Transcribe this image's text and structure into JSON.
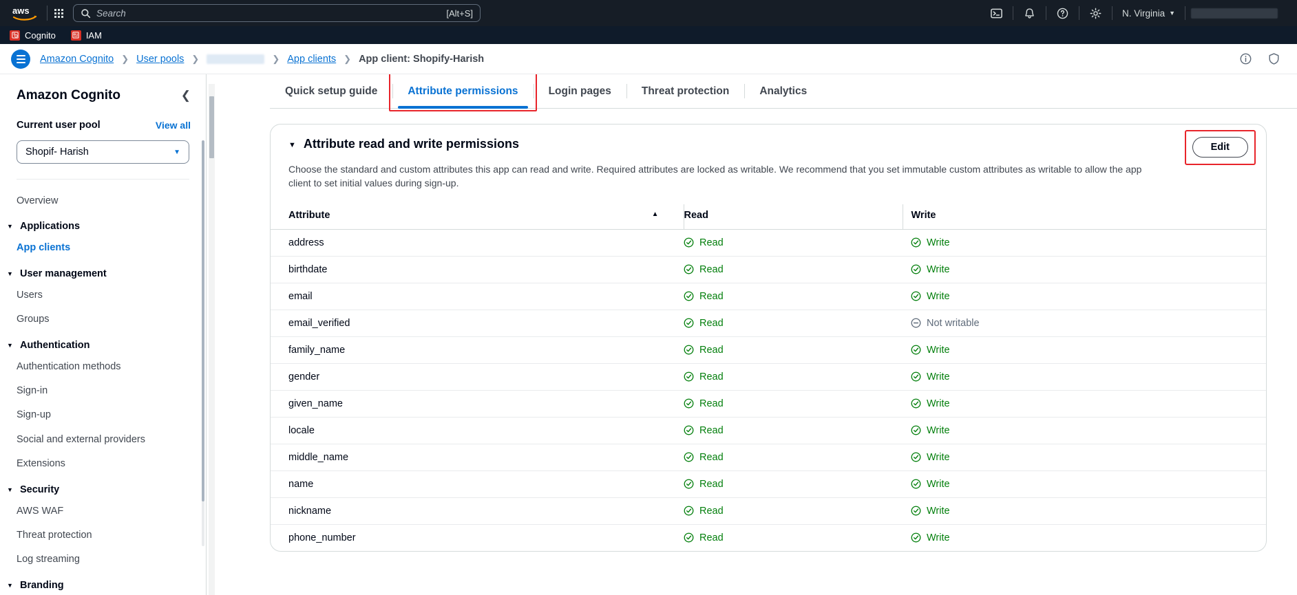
{
  "topnav": {
    "logo": "aws",
    "apps_icon": "app-grid-icon",
    "search_placeholder": "Search",
    "search_value": "",
    "search_shortcut": "[Alt+S]",
    "cloudshell_icon": "cloudshell-icon",
    "notifications_icon": "bell-icon",
    "help_icon": "question-circle-icon",
    "settings_icon": "gear-icon",
    "region": "N. Virginia",
    "region_caret": "chevron-down-icon",
    "account": ""
  },
  "service_bar": {
    "items": [
      {
        "label": "Cognito",
        "icon": "cognito-service-icon"
      },
      {
        "label": "IAM",
        "icon": "iam-service-icon"
      }
    ]
  },
  "breadcrumb": {
    "menu_icon": "hamburger-menu-icon",
    "items": [
      {
        "label": "Amazon Cognito",
        "type": "link"
      },
      {
        "label": "User pools",
        "type": "link"
      },
      {
        "label": "",
        "type": "redacted"
      },
      {
        "label": "App clients",
        "type": "link"
      },
      {
        "label": "App client: Shopify-Harish",
        "type": "current"
      }
    ],
    "separator": "›",
    "info_icon": "info-circle-icon",
    "feedback_icon": "shield-icon"
  },
  "sidebar": {
    "title": "Amazon Cognito",
    "collapse_icon": "chevron-left-icon",
    "pool_label": "Current user pool",
    "view_all": "View all",
    "pool_selected": "Shopif- Harish",
    "pool_caret": "chevron-down-icon",
    "nav": [
      {
        "type": "link",
        "label": "Overview",
        "active": false
      },
      {
        "type": "group",
        "label": "Applications"
      },
      {
        "type": "link",
        "label": "App clients",
        "active": true
      },
      {
        "type": "group",
        "label": "User management"
      },
      {
        "type": "link",
        "label": "Users",
        "active": false
      },
      {
        "type": "link",
        "label": "Groups",
        "active": false
      },
      {
        "type": "group",
        "label": "Authentication"
      },
      {
        "type": "link",
        "label": "Authentication methods",
        "active": false
      },
      {
        "type": "link",
        "label": "Sign-in",
        "active": false
      },
      {
        "type": "link",
        "label": "Sign-up",
        "active": false
      },
      {
        "type": "link",
        "label": "Social and external providers",
        "active": false
      },
      {
        "type": "link",
        "label": "Extensions",
        "active": false
      },
      {
        "type": "group",
        "label": "Security"
      },
      {
        "type": "link",
        "label": "AWS WAF",
        "active": false
      },
      {
        "type": "link",
        "label": "Threat protection",
        "active": false
      },
      {
        "type": "link",
        "label": "Log streaming",
        "active": false
      },
      {
        "type": "group",
        "label": "Branding"
      }
    ]
  },
  "main": {
    "tabs": [
      {
        "label": "Quick setup guide",
        "active": false,
        "highlighted": false
      },
      {
        "label": "Attribute permissions",
        "active": true,
        "highlighted": true
      },
      {
        "label": "Login pages",
        "active": false,
        "highlighted": false
      },
      {
        "label": "Threat protection",
        "active": false,
        "highlighted": false
      },
      {
        "label": "Analytics",
        "active": false,
        "highlighted": false
      }
    ],
    "card": {
      "caret": "caret-down-icon",
      "title": "Attribute read and write permissions",
      "edit_label": "Edit",
      "description": "Choose the standard and custom attributes this app can read and write. Required attributes are locked as writable. We recommend that you set immutable custom attributes as writable to allow the app client to set initial values during sign-up.",
      "columns": {
        "attribute": "Attribute",
        "read": "Read",
        "write": "Write",
        "sort_icon": "sort-ascending-icon"
      },
      "labels": {
        "read_yes": "Read",
        "write_yes": "Write",
        "write_no": "Not writable",
        "yes_icon": "check-circle-icon",
        "no_icon": "minus-circle-icon"
      },
      "rows": [
        {
          "attribute": "address",
          "read": "Read",
          "read_ok": true,
          "write": "Write",
          "write_ok": true
        },
        {
          "attribute": "birthdate",
          "read": "Read",
          "read_ok": true,
          "write": "Write",
          "write_ok": true
        },
        {
          "attribute": "email",
          "read": "Read",
          "read_ok": true,
          "write": "Write",
          "write_ok": true
        },
        {
          "attribute": "email_verified",
          "read": "Read",
          "read_ok": true,
          "write": "Not writable",
          "write_ok": false
        },
        {
          "attribute": "family_name",
          "read": "Read",
          "read_ok": true,
          "write": "Write",
          "write_ok": true
        },
        {
          "attribute": "gender",
          "read": "Read",
          "read_ok": true,
          "write": "Write",
          "write_ok": true
        },
        {
          "attribute": "given_name",
          "read": "Read",
          "read_ok": true,
          "write": "Write",
          "write_ok": true
        },
        {
          "attribute": "locale",
          "read": "Read",
          "read_ok": true,
          "write": "Write",
          "write_ok": true
        },
        {
          "attribute": "middle_name",
          "read": "Read",
          "read_ok": true,
          "write": "Write",
          "write_ok": true
        },
        {
          "attribute": "name",
          "read": "Read",
          "read_ok": true,
          "write": "Write",
          "write_ok": true
        },
        {
          "attribute": "nickname",
          "read": "Read",
          "read_ok": true,
          "write": "Write",
          "write_ok": true
        },
        {
          "attribute": "phone_number",
          "read": "Read",
          "read_ok": true,
          "write": "Write",
          "write_ok": true
        }
      ]
    }
  },
  "colors": {
    "nav_bg": "#161d26",
    "service_bg": "#0f1b2a",
    "link": "#0972d3",
    "green": "#037f0c",
    "gray": "#5f6b7a",
    "highlight_red": "#e8242a",
    "aws_orange": "#ff9900"
  }
}
